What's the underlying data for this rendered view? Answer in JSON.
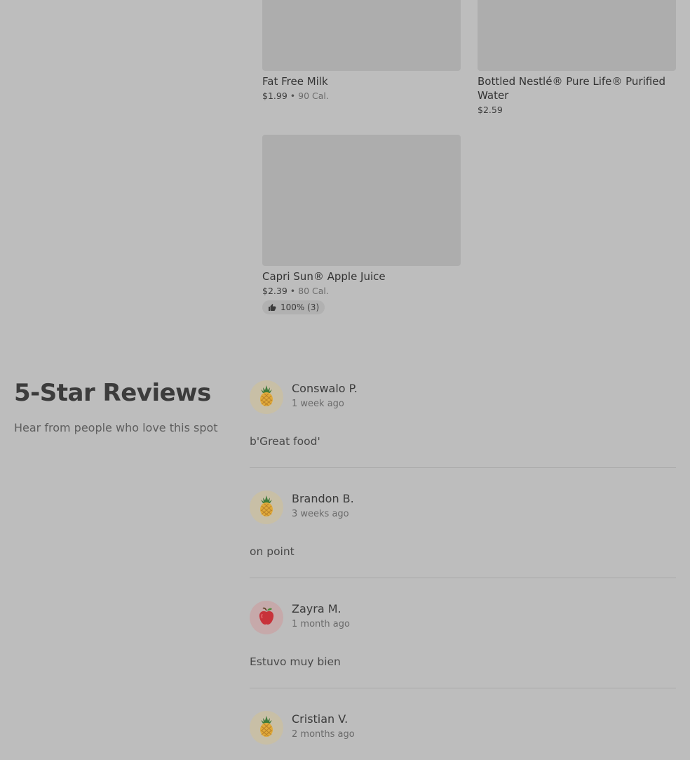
{
  "menu_items": [
    {
      "name": "Fat Free Milk",
      "price": "$1.99",
      "separator": "•",
      "calories": "90 Cal."
    },
    {
      "name": "Bottled Nestlé® Pure Life® Purified Water",
      "price": "$2.59"
    },
    {
      "name": "Capri Sun® Apple Juice",
      "price": "$2.39",
      "separator": "•",
      "calories": "80 Cal.",
      "rating": "100% (3)"
    }
  ],
  "reviews_section": {
    "title": "5-Star Reviews",
    "subtitle": "Hear from people who love this spot"
  },
  "reviews": [
    {
      "name": "Conswalo P.",
      "time": "1 week ago",
      "text": "b'Great food'",
      "avatar_icon": "pineapple-icon"
    },
    {
      "name": "Brandon B.",
      "time": "3 weeks ago",
      "text": "on point",
      "avatar_icon": "pineapple-icon"
    },
    {
      "name": "Zayra M.",
      "time": "1 month ago",
      "text": "Estuvo muy bien",
      "avatar_icon": "apple-icon"
    },
    {
      "name": "Cristian V.",
      "time": "2 months ago",
      "text": "",
      "avatar_icon": "pineapple-icon"
    }
  ],
  "colors": {
    "background": "#bdbdbd",
    "image_placeholder": "#adadad",
    "pineapple_avatar_bg": "#c8bfa6",
    "apple_avatar_bg": "#c6a9aa"
  }
}
